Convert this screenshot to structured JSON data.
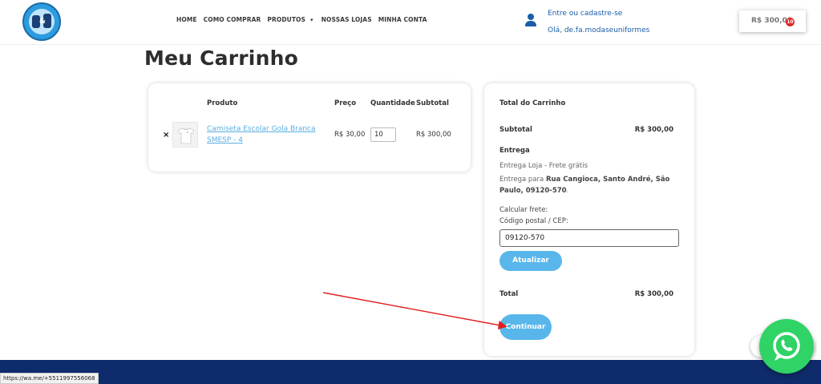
{
  "header": {
    "nav": [
      {
        "label": "HOME"
      },
      {
        "label": "COMO COMPRAR"
      },
      {
        "label": "PRODUTOS"
      },
      {
        "label": "NOSSAS LOJAS"
      },
      {
        "label": "MINHA CONTA"
      }
    ],
    "login_link": "Entre ou cadastre-se",
    "greeting": "Olá, de.fa.modaseuniformes",
    "cart_amount": "R$ 300,00",
    "cart_count": "10"
  },
  "page_title": "Meu Carrinho",
  "cart_table": {
    "columns": [
      "Produto",
      "Preço",
      "Quantidade",
      "Subtotal"
    ],
    "rows": [
      {
        "remove": "×",
        "product": "Camiseta Escolar Gola Branca SMESP - 4",
        "price": "R$ 30,00",
        "quantity": "10",
        "subtotal": "R$ 300,00"
      }
    ]
  },
  "totals": {
    "title": "Total do Carrinho",
    "subtotal_label": "Subtotal",
    "subtotal_value": "R$ 300,00",
    "shipping_label": "Entrega",
    "shipping_method": "Entrega Loja - Frete grátis",
    "shipping_to_prefix": "Entrega para ",
    "shipping_address": "Rua Cangioca, Santo André, São Paulo, 09120-570",
    "calc_label": "Calcular frete:",
    "postal_label": "Código postal / CEP:",
    "postal_value": "09120-570",
    "update_button": "Atualizar",
    "total_label": "Total",
    "total_value": "R$ 300,00",
    "continue_button": "Continuar"
  },
  "status_bar_url": "https://wa.me/+5511997556068",
  "colors": {
    "accent_blue": "#58b6ea",
    "link_blue": "#1a5da8",
    "badge_red": "#e0272a",
    "footer_navy": "#0e2c6b",
    "whatsapp_green": "#2fd366",
    "annotation_arrow": "#e02020"
  }
}
